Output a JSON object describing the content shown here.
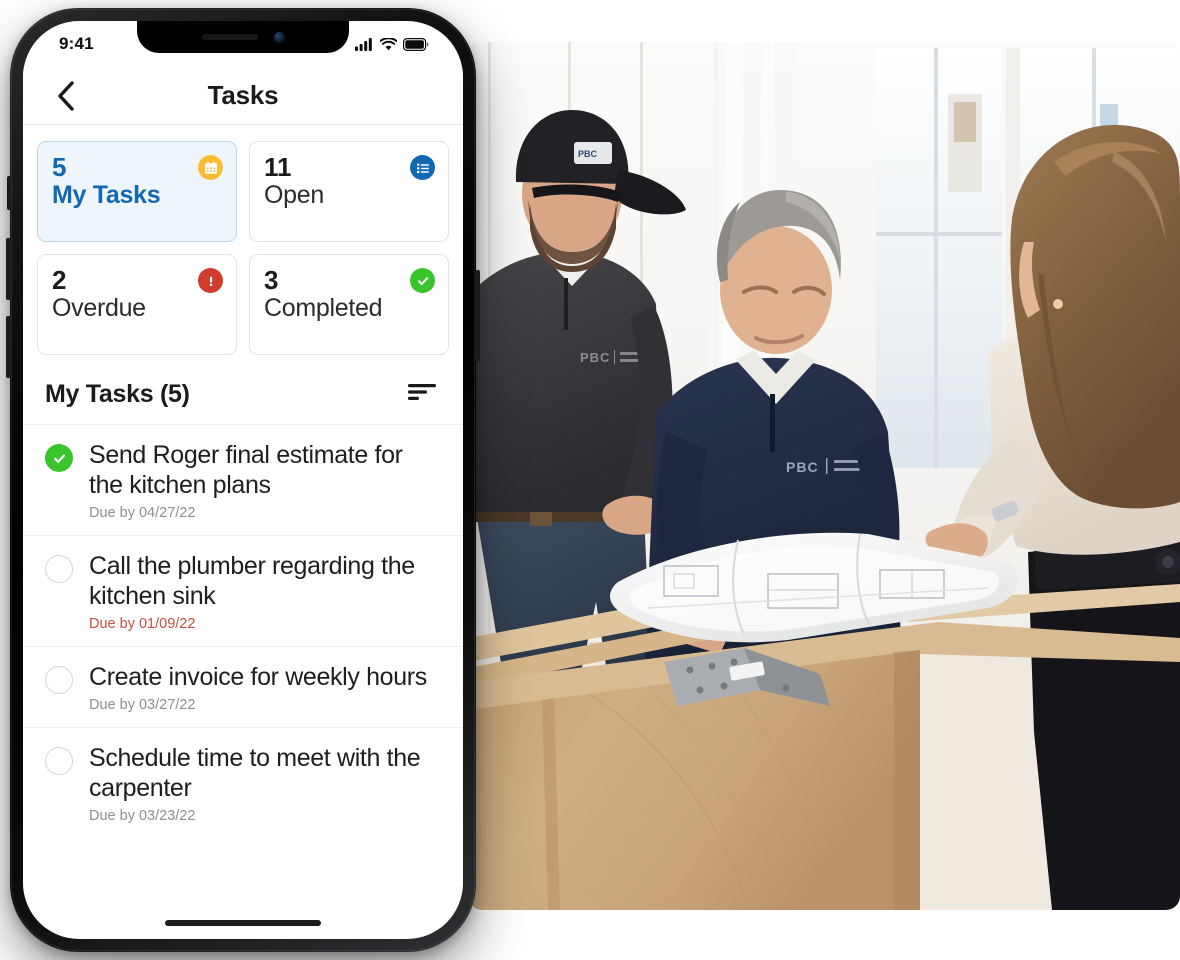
{
  "status_bar": {
    "time": "9:41",
    "signal_icon": "cellular-signal-icon",
    "wifi_icon": "wifi-icon",
    "battery_icon": "battery-icon"
  },
  "nav": {
    "back_icon": "chevron-left-icon",
    "title": "Tasks"
  },
  "stat_cards": [
    {
      "count": "5",
      "label": "My Tasks",
      "icon": "calendar-icon",
      "icon_color": "#FCBB34",
      "selected": true
    },
    {
      "count": "11",
      "label": "Open",
      "icon": "list-icon",
      "icon_color": "#1268B3",
      "selected": false
    },
    {
      "count": "2",
      "label": "Overdue",
      "icon": "alert-icon",
      "icon_color": "#CF3B2C",
      "selected": false
    },
    {
      "count": "3",
      "label": "Completed",
      "icon": "check-circle-icon",
      "icon_color": "#39C42C",
      "selected": false
    }
  ],
  "section": {
    "title": "My Tasks (5)",
    "sort_icon": "sort-icon"
  },
  "tasks": [
    {
      "title": "Send Roger final estimate for the kitchen plans",
      "due": "Due by 04/27/22",
      "completed": true,
      "overdue": false
    },
    {
      "title": "Call the plumber regarding the kitchen sink",
      "due": "Due by 01/09/22",
      "completed": false,
      "overdue": true
    },
    {
      "title": "Create invoice for weekly hours",
      "due": "Due by 03/27/22",
      "completed": false,
      "overdue": false
    },
    {
      "title": "Schedule time to meet with the carpenter",
      "due": "Due by 03/23/22",
      "completed": false,
      "overdue": false
    }
  ],
  "photo": {
    "alt": "Three construction professionals reviewing blueprints on a plywood kitchen island in a bright renovated interior"
  },
  "colors": {
    "accent_blue": "#1268B3",
    "selected_card_bg": "#EEF6FB",
    "overdue_red": "#C4503F",
    "done_green": "#39C42C",
    "warn_red": "#CF3B2C",
    "calendar_yellow": "#FCBB34"
  }
}
